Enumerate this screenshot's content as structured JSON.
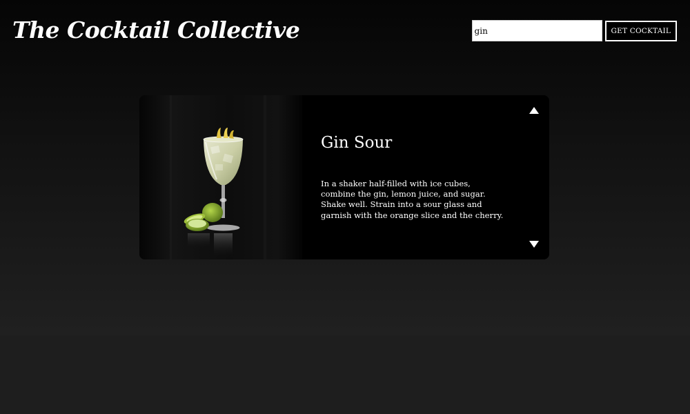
{
  "header": {
    "title": "The Cocktail Collective"
  },
  "search": {
    "value": "gin",
    "button_label": "GET COCKTAIL"
  },
  "cocktail": {
    "name": "Gin Sour",
    "instructions": "In a shaker half-filled with ice cubes, combine the gin, lemon juice, and sugar. Shake well. Strain into a sour glass and garnish with the orange slice and the cherry.",
    "image_icon": "cocktail-glass-photo"
  },
  "navigation": {
    "previous_icon": "triangle-up-icon",
    "next_icon": "triangle-down-icon"
  },
  "colors": {
    "page_background": "#1e1e1e",
    "card_background": "#000000",
    "text": "#ffffff",
    "lime": "#8ab02e"
  }
}
